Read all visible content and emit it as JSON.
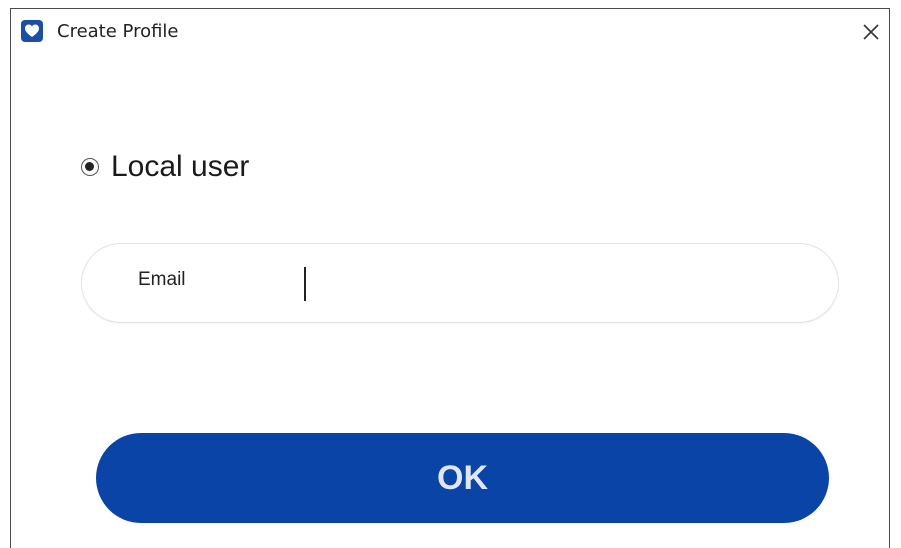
{
  "window": {
    "title": "Create Profile",
    "icon": "heart-icon",
    "close_icon": "close-icon"
  },
  "profile_type": {
    "option_label": "Local user",
    "selected": true
  },
  "email_field": {
    "label": "Email",
    "value": ""
  },
  "actions": {
    "ok_label": "OK"
  },
  "colors": {
    "accent": "#0a44a6",
    "app_icon": "#1c4fa3"
  }
}
